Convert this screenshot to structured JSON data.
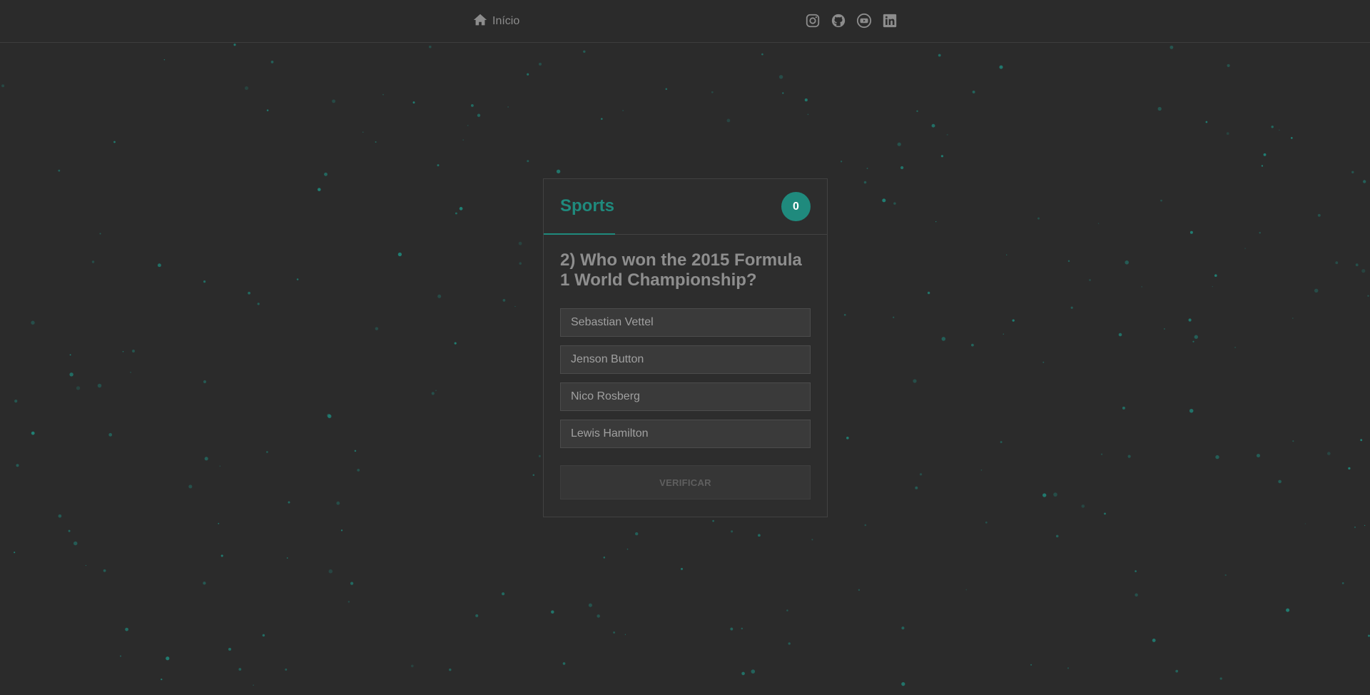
{
  "nav": {
    "home_label": "Início",
    "home_icon": "home-icon",
    "socials": [
      "instagram-icon",
      "github-icon",
      "youtube-icon",
      "linkedin-icon"
    ]
  },
  "quiz": {
    "category": "Sports",
    "score": "0",
    "question": "2) Who won the 2015 Formula 1 World Championship?",
    "options": [
      "Sebastian Vettel",
      "Jenson Button",
      "Nico Rosberg",
      "Lewis Hamilton"
    ],
    "verify_label": "VERIFICAR"
  },
  "colors": {
    "background": "#2b2b2b",
    "accent": "#1f8a7d",
    "particle": "#1f8a7d"
  }
}
